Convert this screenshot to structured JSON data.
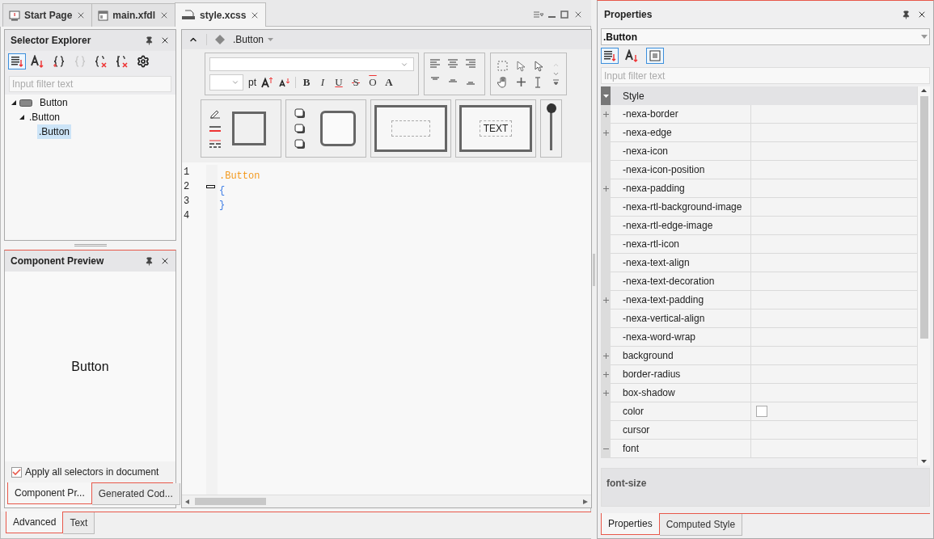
{
  "document_tabs": [
    {
      "label": "Start Page",
      "kind": "start",
      "selected": false
    },
    {
      "label": "main.xfdl",
      "kind": "form",
      "selected": false
    },
    {
      "label": "style.xcss",
      "kind": "css",
      "selected": true
    }
  ],
  "selector_explorer": {
    "title": "Selector Explorer",
    "tools": [
      {
        "kind": "sort-category",
        "selected": true,
        "disabled": false
      },
      {
        "kind": "sort-alpha",
        "selected": false,
        "disabled": false
      },
      {
        "kind": "add-braces",
        "selected": false,
        "disabled": false
      },
      {
        "kind": "remove-braces",
        "selected": false,
        "disabled": true
      },
      {
        "kind": "delete",
        "selected": false,
        "disabled": false
      },
      {
        "kind": "delete-all",
        "selected": false,
        "disabled": false
      },
      {
        "kind": "settings",
        "selected": false,
        "disabled": false
      }
    ],
    "filter": {
      "placeholder": "Input filter text"
    },
    "tree": [
      {
        "label": "Button",
        "kind": "component",
        "expanded": true,
        "selected": false,
        "children": [
          {
            "label": ".Button",
            "expanded": true,
            "selected": false,
            "children": [
              {
                "label": ".Button",
                "selected": true
              }
            ]
          }
        ]
      }
    ]
  },
  "component_preview": {
    "title": "Component Preview",
    "preview_text": "Button",
    "apply_all": {
      "label": "Apply all selectors in document",
      "checked": true
    },
    "tabs": [
      {
        "label": "Component Pr...",
        "selected": true
      },
      {
        "label": "Generated Cod...",
        "selected": false
      }
    ]
  },
  "editor": {
    "breadcrumb": ".Button",
    "format_toolbar": {
      "size_unit": "pt",
      "text_buttons": [
        {
          "label": "B",
          "kind": "bold"
        },
        {
          "label": "I",
          "kind": "italic"
        },
        {
          "label": "U",
          "kind": "underline"
        },
        {
          "label": "S",
          "kind": "strike"
        },
        {
          "label": "O",
          "kind": "overline"
        },
        {
          "label": "A",
          "kind": "color"
        }
      ],
      "padding_sample": "TEXT",
      "opacity_slider": {
        "level": 1
      }
    },
    "lines": [
      {
        "number": "1",
        "text": ".Button",
        "kind": "selector",
        "fold": false
      },
      {
        "number": "2",
        "text": "{",
        "kind": "brace",
        "fold": true
      },
      {
        "number": "3",
        "text": "}",
        "kind": "brace",
        "fold": false
      },
      {
        "number": "4",
        "fold": false
      }
    ],
    "view_tabs": [
      {
        "label": "Advanced",
        "selected": true
      },
      {
        "label": "Text",
        "selected": false
      }
    ]
  },
  "properties": {
    "title": "Properties",
    "target": ".Button",
    "tools": [
      {
        "kind": "sort-category",
        "selected": true
      },
      {
        "kind": "sort-alpha",
        "selected": false
      },
      {
        "kind": "description",
        "selected": true
      }
    ],
    "filter": {
      "placeholder": "Input filter text"
    },
    "category": {
      "label": "Style",
      "expanded": true
    },
    "rows": [
      {
        "name": "-nexa-border",
        "kind": "group",
        "expanded": false
      },
      {
        "name": "-nexa-edge",
        "kind": "group",
        "expanded": false
      },
      {
        "name": "-nexa-icon",
        "kind": "property"
      },
      {
        "name": "-nexa-icon-position",
        "kind": "property"
      },
      {
        "name": "-nexa-padding",
        "kind": "group",
        "expanded": false
      },
      {
        "name": "-nexa-rtl-background-image",
        "kind": "property"
      },
      {
        "name": "-nexa-rtl-edge-image",
        "kind": "property"
      },
      {
        "name": "-nexa-rtl-icon",
        "kind": "property"
      },
      {
        "name": "-nexa-text-align",
        "kind": "property"
      },
      {
        "name": "-nexa-text-decoration",
        "kind": "property"
      },
      {
        "name": "-nexa-text-padding",
        "kind": "group",
        "expanded": false
      },
      {
        "name": "-nexa-vertical-align",
        "kind": "property"
      },
      {
        "name": "-nexa-word-wrap",
        "kind": "property"
      },
      {
        "name": "background",
        "kind": "group",
        "expanded": false
      },
      {
        "name": "border-radius",
        "kind": "group",
        "expanded": false
      },
      {
        "name": "box-shadow",
        "kind": "group",
        "expanded": false
      },
      {
        "name": "color",
        "kind": "color"
      },
      {
        "name": "cursor",
        "kind": "property"
      },
      {
        "name": "font",
        "kind": "group",
        "expanded": true
      }
    ],
    "description": "font-size",
    "tabs": [
      {
        "label": "Properties",
        "selected": true
      },
      {
        "label": "Computed Style",
        "selected": false
      }
    ]
  }
}
